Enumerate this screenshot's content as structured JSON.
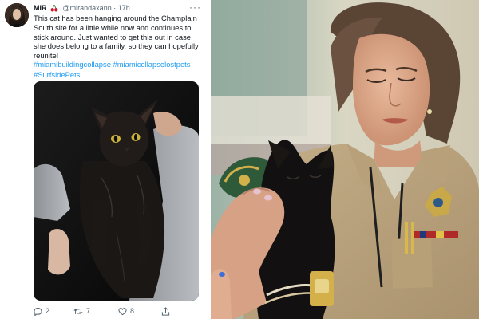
{
  "tweet": {
    "display_name": "MIR",
    "handle_time": "@mirandaxann · 17h",
    "more_label": "···",
    "body": "This cat has been hanging around the Champlain South site for a little while now and continues to stick around. Just wanted to get this out in case she does belong to a family, so they can hopefully reunite!",
    "hashtags": "#miamibuildingcollapse #miamicollapselostpets #SurfsidePets",
    "actions": {
      "reply_count": "2",
      "retweet_count": "7",
      "like_count": "8"
    },
    "icons": [
      "cherry-icon",
      "reply-icon",
      "retweet-icon",
      "like-icon",
      "share-icon"
    ]
  },
  "colors": {
    "link": "#1d9bf0",
    "text": "#0f1419",
    "secondary": "#536471",
    "uniform": "#bfa783"
  }
}
